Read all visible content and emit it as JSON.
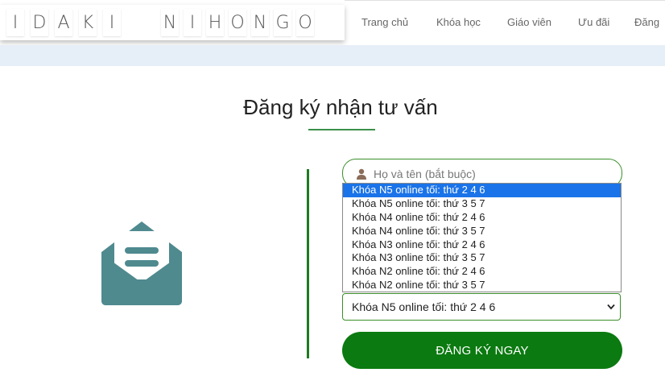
{
  "brand": {
    "letters": [
      "I",
      "D",
      "A",
      "K",
      "I",
      "N",
      "I",
      "H",
      "O",
      "N",
      "G",
      "O"
    ]
  },
  "nav": {
    "items": [
      "Trang chủ",
      "Khóa học",
      "Giáo viên",
      "Ưu đãi",
      "Đăng"
    ]
  },
  "form": {
    "title": "Đăng ký nhận tư vấn",
    "name_placeholder": "Họ và tên (bắt buộc)",
    "course_options": [
      "Khóa N5 online tối: thứ 2 4 6",
      "Khóa N5 online tối: thứ 3 5 7",
      "Khóa N4 online tối: thứ 2 4 6",
      "Khóa N4 online tối: thứ 3 5 7",
      "Khóa N3 online tối: thứ 2 4 6",
      "Khóa N3 online tối: thứ 3 5 7",
      "Khóa N2 online tối: thứ 2 4 6",
      "Khóa N2 online tối: thứ 3 5 7"
    ],
    "selected_course": "Khóa N5 online tối: thứ 2 4 6",
    "submit_label": "ĐĂNG KÝ NGAY"
  },
  "colors": {
    "accent_green": "#0b7a10",
    "icon_teal": "#4f8a8f",
    "highlight_blue": "#1a73e8"
  },
  "icons": [
    "envelope-open-icon",
    "person-icon",
    "chevron-down-icon"
  ]
}
